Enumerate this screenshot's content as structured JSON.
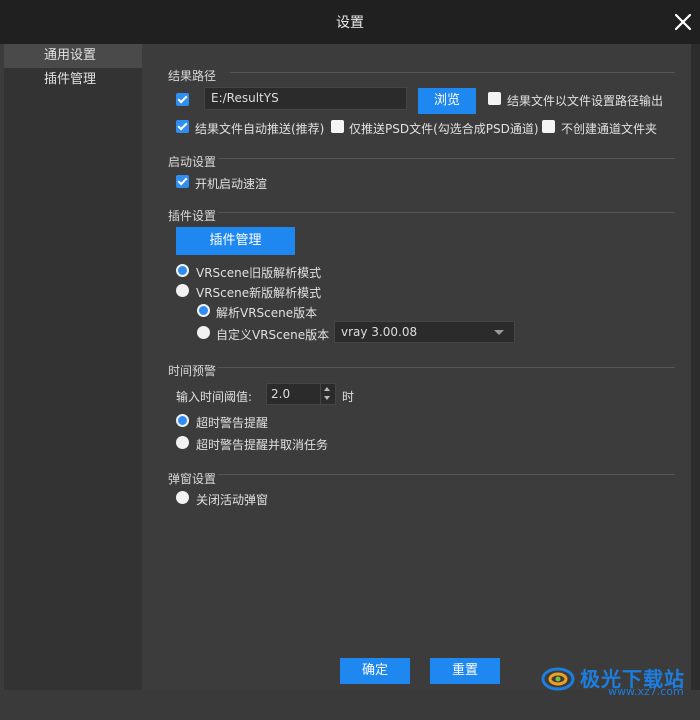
{
  "window": {
    "title": "设置",
    "close_icon": "close-icon"
  },
  "sidebar": {
    "items": [
      {
        "label": "通用设置",
        "active": true
      },
      {
        "label": "插件管理",
        "active": false
      }
    ]
  },
  "result_path": {
    "section": "结果路径",
    "enabled": true,
    "path_value": "E:/ResultYS",
    "browse_label": "浏览",
    "output_by_settings_label": "结果文件以文件设置路径输出",
    "output_by_settings_checked": false,
    "auto_push_label": "结果文件自动推送(推荐)",
    "auto_push_checked": true,
    "psd_only_label": "仅推送PSD文件(勾选合成PSD通道)",
    "psd_only_checked": false,
    "no_channel_folder_label": "不创建通道文件夹",
    "no_channel_folder_checked": false
  },
  "startup": {
    "section": "启动设置",
    "quick_render_label": "开机启动速渲",
    "quick_render_checked": true
  },
  "plugins": {
    "section": "插件设置",
    "manage_button": "插件管理",
    "old_mode_label": "VRScene旧版解析模式",
    "new_mode_label": "VRScene新版解析模式",
    "parse_version_label": "解析VRScene版本",
    "custom_version_label": "自定义VRScene版本",
    "selected_mode": "old",
    "selected_sub": "parse",
    "version_select": "vray 3.00.08"
  },
  "time_warning": {
    "section": "时间预警",
    "threshold_label": "输入时间阈值:",
    "threshold_value": "2.0",
    "unit": "时",
    "warn_label": "超时警告提醒",
    "warn_cancel_label": "超时警告提醒并取消任务",
    "selected": "warn"
  },
  "popup": {
    "section": "弹窗设置",
    "close_activity_label": "关闭活动弹窗",
    "close_activity_checked": false
  },
  "footer": {
    "ok": "确定",
    "reset": "重置"
  },
  "watermark": {
    "text": "极光下载站",
    "url": "www.xz7.com"
  },
  "colors": {
    "accent": "#1e88f0",
    "background": "#3c3c3c",
    "titlebar": "#202020"
  }
}
